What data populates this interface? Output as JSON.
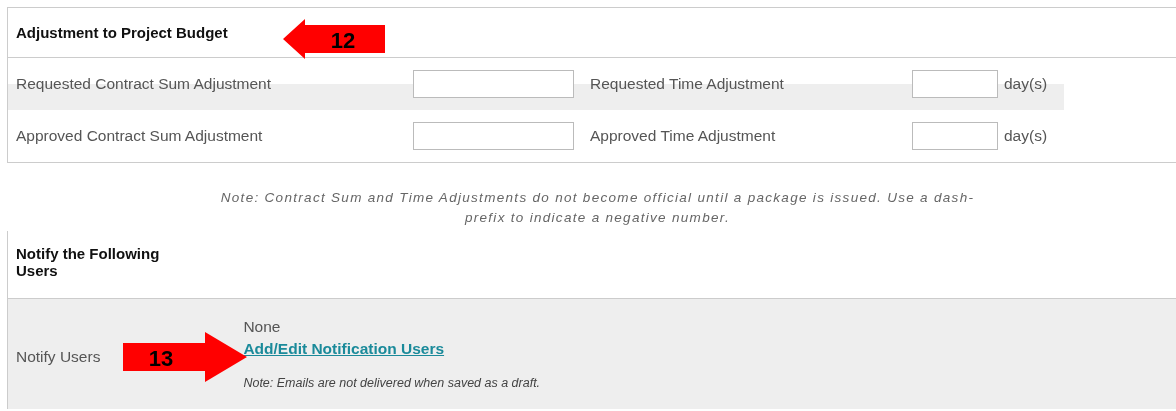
{
  "budget_section": {
    "title": "Adjustment to Project Budget",
    "callout": "12",
    "rows": [
      {
        "label": "Requested Contract Sum Adjustment",
        "time_label": "Requested Time Adjustment",
        "unit": "day(s)",
        "highlighted": true
      },
      {
        "label": "Approved Contract Sum Adjustment",
        "time_label": "Approved Time Adjustment",
        "unit": "day(s)",
        "highlighted": false
      }
    ]
  },
  "note": "Note: Contract Sum and Time Adjustments do not become official until a package is issued. Use a dash-prefix to indicate a negative number.",
  "notify_section": {
    "title": "Notify the Following Users",
    "label": "Notify Users",
    "callout": "13",
    "users": "None",
    "link": "Add/Edit Notification Users",
    "note": "Note: Emails are not delivered when saved as a draft."
  }
}
